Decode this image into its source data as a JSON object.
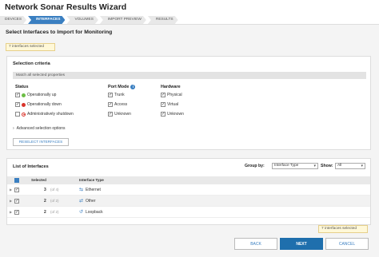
{
  "window": {
    "title": "Network Sonar Results Wizard"
  },
  "steps": [
    "DEVICES",
    "INTERFACES",
    "VOLUMES",
    "IMPORT PREVIEW",
    "RESULTS"
  ],
  "page": {
    "subtitle": "Select Interfaces to Import for Monitoring",
    "selected_badge": "7 interfaces selected"
  },
  "criteria": {
    "heading": "Selection criteria",
    "match": "Match all selected properties",
    "status": {
      "heading": "Status",
      "items": [
        "Operationally up",
        "Operationally down",
        "Administratively shutdown"
      ]
    },
    "port_mode": {
      "heading": "Port Mode",
      "items": [
        "Trunk",
        "Access",
        "Unknown"
      ]
    },
    "hardware": {
      "heading": "Hardware",
      "items": [
        "Physical",
        "Virtual",
        "Unknown"
      ]
    },
    "advanced": "Advanced selection options",
    "reselect": "RESELECT INTERFACES"
  },
  "list": {
    "heading": "List of Interfaces",
    "group_by_label": "Group by:",
    "group_by_value": "Interface Type",
    "show_label": "Show:",
    "show_value": "All",
    "columns": {
      "selected": "Selected",
      "type": "Interface Type"
    },
    "rows": [
      {
        "count": "3",
        "of": "(of 4)",
        "type": "Ethernet",
        "icon": "ethernet-icon"
      },
      {
        "count": "2",
        "of": "(of 2)",
        "type": "Other",
        "icon": "other-icon"
      },
      {
        "count": "2",
        "of": "(of 2)",
        "type": "Loopback",
        "icon": "loopback-icon"
      }
    ]
  },
  "footer": {
    "selected_badge": "7 interfaces selected",
    "back": "BACK",
    "next": "NEXT",
    "cancel": "CANCEL"
  },
  "colors": {
    "accent": "#3a7fc1",
    "primary_button": "#1f6fad",
    "badge_bg": "#fff8d8"
  }
}
